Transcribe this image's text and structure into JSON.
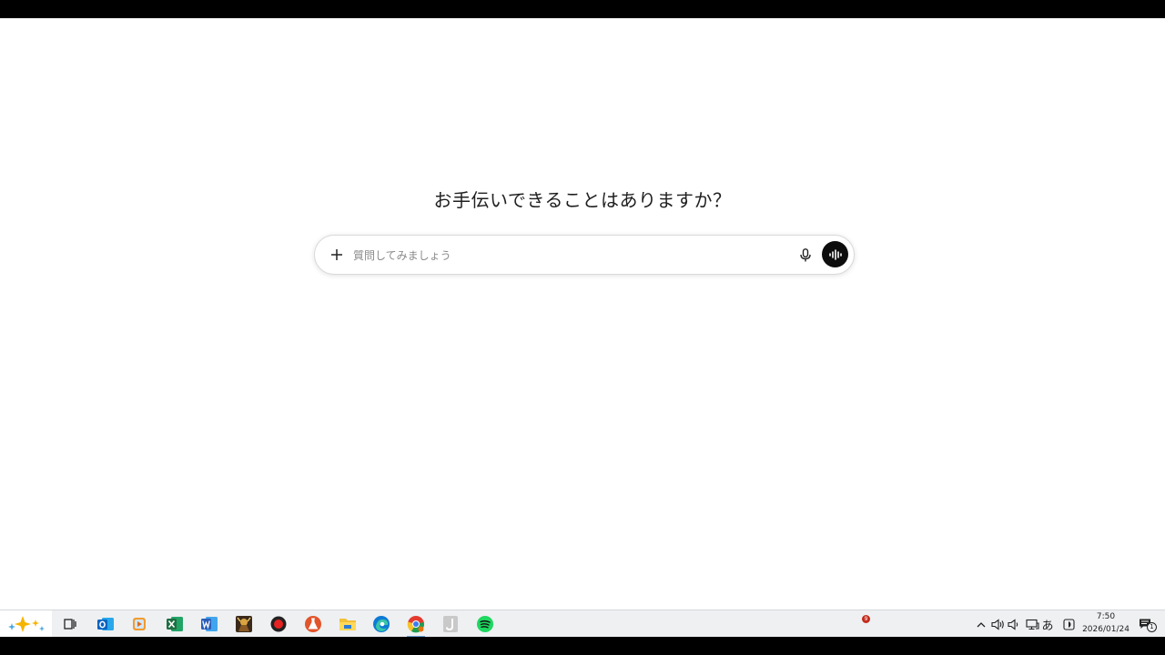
{
  "main": {
    "heading": "お手伝いできることはありますか？",
    "prompt": {
      "placeholder": "質問してみましょう"
    }
  },
  "taskbar": {
    "apps": [
      {
        "name": "task-view",
        "icon": "task-view-icon"
      },
      {
        "name": "outlook",
        "icon": "outlook-icon",
        "letter": "O",
        "color": "#0a64c2"
      },
      {
        "name": "media-player",
        "icon": "media-player-icon"
      },
      {
        "name": "excel",
        "icon": "excel-icon",
        "letter": "X",
        "color": "#1d6f42"
      },
      {
        "name": "word",
        "icon": "word-icon",
        "letter": "W",
        "color": "#2b5eb8"
      },
      {
        "name": "game",
        "icon": "game-icon"
      },
      {
        "name": "recorder",
        "icon": "record-icon"
      },
      {
        "name": "flask-app",
        "icon": "flask-icon"
      },
      {
        "name": "file-explorer",
        "icon": "folder-icon"
      },
      {
        "name": "edge",
        "icon": "edge-icon"
      },
      {
        "name": "chrome",
        "icon": "chrome-icon"
      },
      {
        "name": "j-app",
        "icon": "j-app-icon",
        "letter": "J"
      },
      {
        "name": "spotify",
        "icon": "spotify-icon"
      }
    ],
    "notification_count": "9",
    "tray": {
      "ime": "あ",
      "time": "7:50",
      "date": "2026/01/24",
      "action_center_count": "1"
    }
  }
}
